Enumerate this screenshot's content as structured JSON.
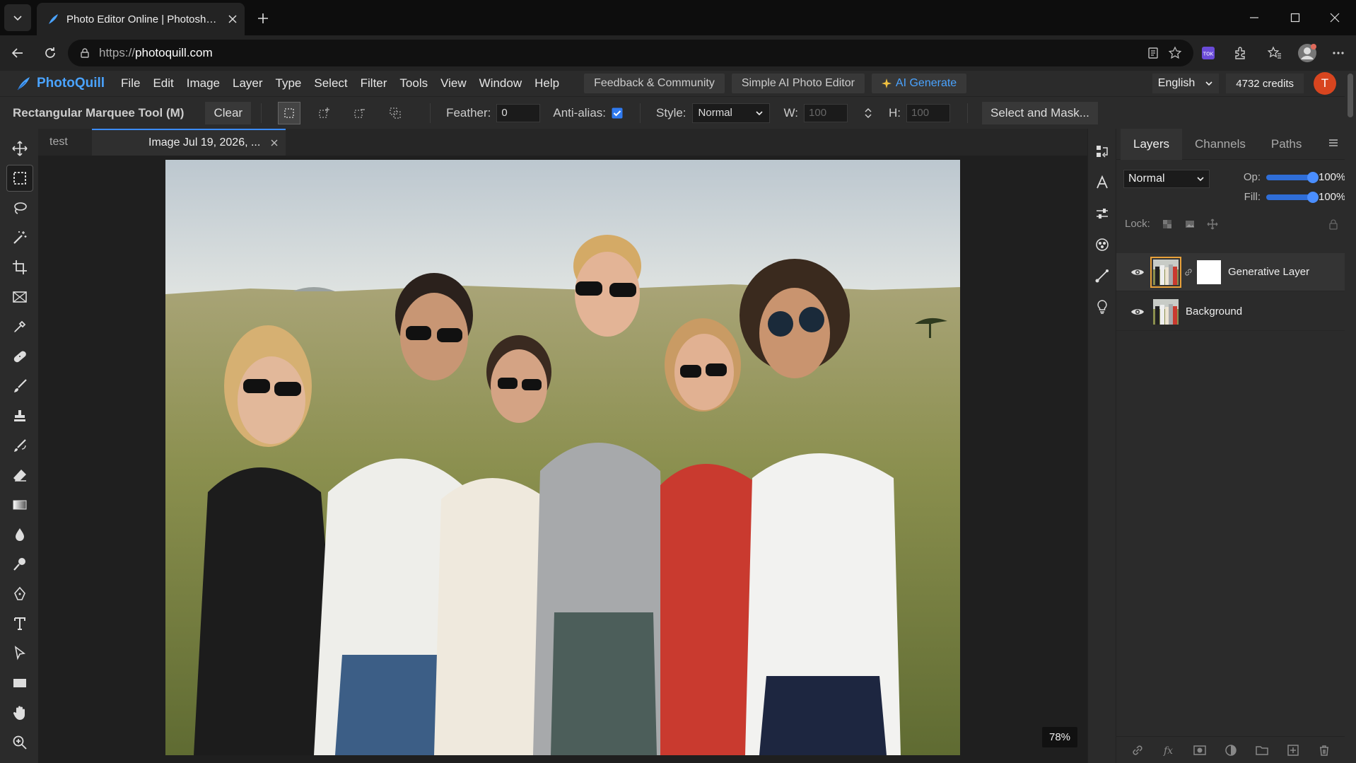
{
  "browser": {
    "tab_title": "Photo Editor Online | Photoshop A",
    "url_protocol": "https://",
    "url_host": "photoquill.com"
  },
  "app": {
    "brand": "PhotoQuill",
    "menu": [
      "File",
      "Edit",
      "Image",
      "Layer",
      "Type",
      "Select",
      "Filter",
      "Tools",
      "View",
      "Window",
      "Help"
    ],
    "feedback_label": "Feedback & Community",
    "simple_ai_label": "Simple AI Photo Editor",
    "ai_generate_label": "AI Generate",
    "language": "English",
    "credits": "4732 credits",
    "avatar_initial": "T",
    "accent": "#4aa3ff",
    "avatar_color": "#d8451f"
  },
  "options": {
    "tool_name": "Rectangular Marquee Tool (M)",
    "clear_label": "Clear",
    "feather_label": "Feather:",
    "feather_value": "0",
    "antialias_label": "Anti-alias:",
    "antialias_checked": true,
    "style_label": "Style:",
    "style_value": "Normal",
    "w_label": "W:",
    "w_value": "100",
    "h_label": "H:",
    "h_value": "100",
    "select_mask_label": "Select and Mask..."
  },
  "documents": {
    "tabs": [
      "test",
      "Image Jul 19, 2026, ..."
    ],
    "zoom": "78%"
  },
  "layers_panel": {
    "tabs": [
      "Layers",
      "Channels",
      "Paths"
    ],
    "blend_mode": "Normal",
    "opacity_label": "Op:",
    "opacity": "100%",
    "opacity_fraction": 1,
    "fill_label": "Fill:",
    "fill": "100%",
    "fill_fraction": 1,
    "lock_label": "Lock:",
    "layers": [
      {
        "name": "Generative Layer",
        "visible": true,
        "selected": true
      },
      {
        "name": "Background",
        "visible": true,
        "selected": false
      }
    ]
  }
}
